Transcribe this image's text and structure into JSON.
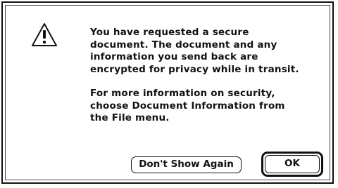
{
  "dialog": {
    "icon": "warning-icon",
    "paragraphs": [
      "You have requested a secure\ndocument.  The document and any\ninformation you send back are\nencrypted for privacy while in transit.",
      "For more information on security,\nchoose Document Information from\nthe File menu."
    ],
    "buttons": {
      "dont_show_again": "Don't Show Again",
      "ok": "OK"
    }
  }
}
